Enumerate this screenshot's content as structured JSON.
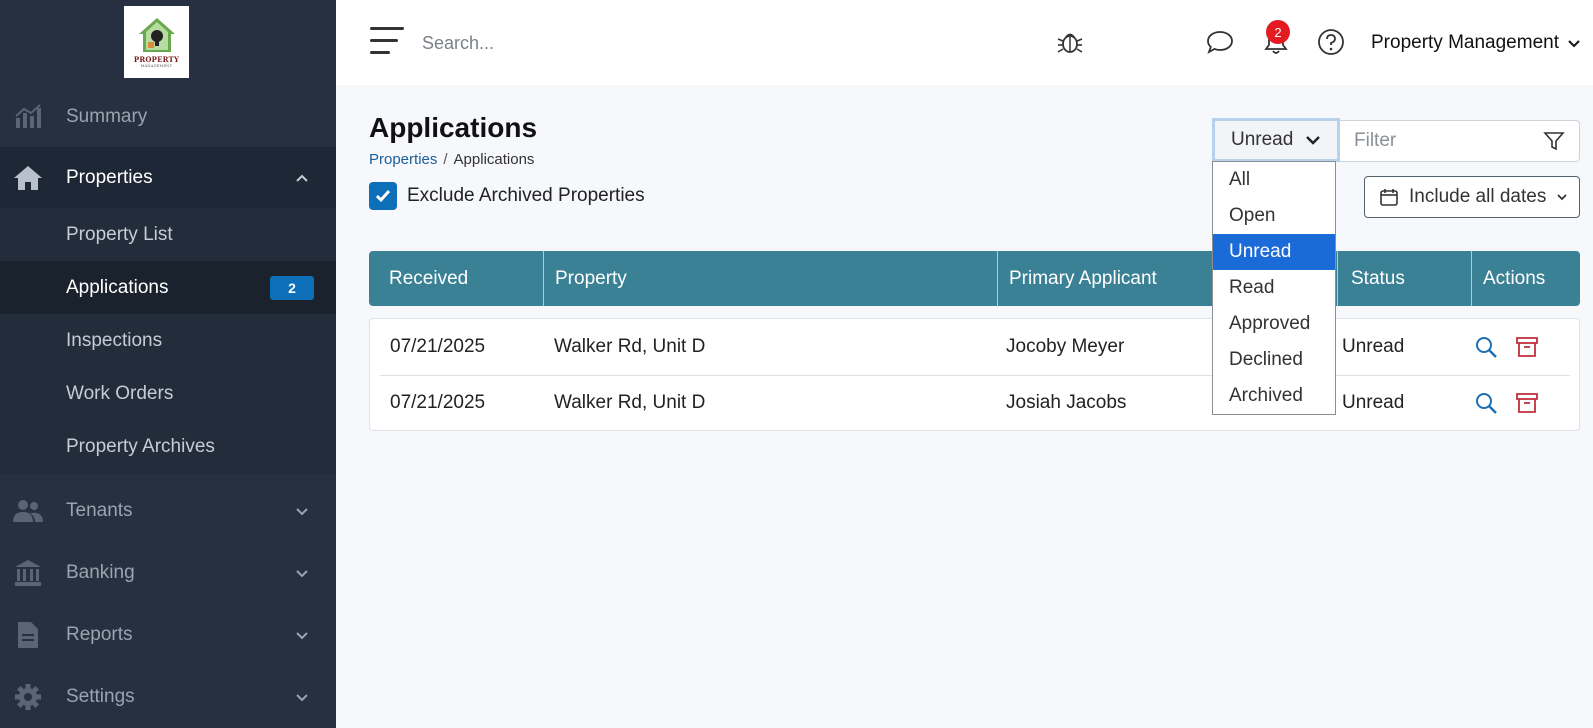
{
  "logo": {
    "line1": "PROPERTY",
    "line2": "MANAGEMENT"
  },
  "sidebar": {
    "items": [
      {
        "label": "Summary",
        "icon": "chart-icon"
      },
      {
        "label": "Properties",
        "icon": "home-icon"
      },
      {
        "label": "Tenants",
        "icon": "users-icon"
      },
      {
        "label": "Banking",
        "icon": "bank-icon"
      },
      {
        "label": "Reports",
        "icon": "file-icon"
      },
      {
        "label": "Settings",
        "icon": "gear-icon"
      }
    ],
    "sub_items": [
      {
        "label": "Property List"
      },
      {
        "label": "Applications",
        "badge": "2"
      },
      {
        "label": "Inspections"
      },
      {
        "label": "Work Orders"
      },
      {
        "label": "Property Archives"
      }
    ]
  },
  "topbar": {
    "search_placeholder": "Search...",
    "notification_count": "2",
    "account_label": "Property Management"
  },
  "page": {
    "title": "Applications",
    "breadcrumb": {
      "link": "Properties",
      "sep": "/",
      "current": "Applications"
    },
    "exclude_archived_label": "Exclude Archived Properties",
    "exclude_archived_checked": true
  },
  "filters": {
    "status_selected": "Unread",
    "filter_placeholder": "Filter",
    "dates_label": "Include all dates",
    "status_options": [
      "All",
      "Open",
      "Unread",
      "Read",
      "Approved",
      "Declined",
      "Archived"
    ]
  },
  "table": {
    "headers": [
      "Received",
      "Property",
      "Primary Applicant",
      "Status",
      "Actions"
    ],
    "rows": [
      {
        "received": "07/21/2025",
        "property": "Walker Rd, Unit D",
        "applicant": "Jocoby Meyer",
        "status": "Unread"
      },
      {
        "received": "07/21/2025",
        "property": "Walker Rd, Unit D",
        "applicant": "Josiah Jacobs",
        "status": "Unread"
      }
    ]
  },
  "colors": {
    "sidebar_bg": "#263040",
    "accent": "#0d6fb8",
    "table_header": "#3a8196",
    "selected_option": "#1a6ad8",
    "archive_icon": "#c0323d"
  }
}
